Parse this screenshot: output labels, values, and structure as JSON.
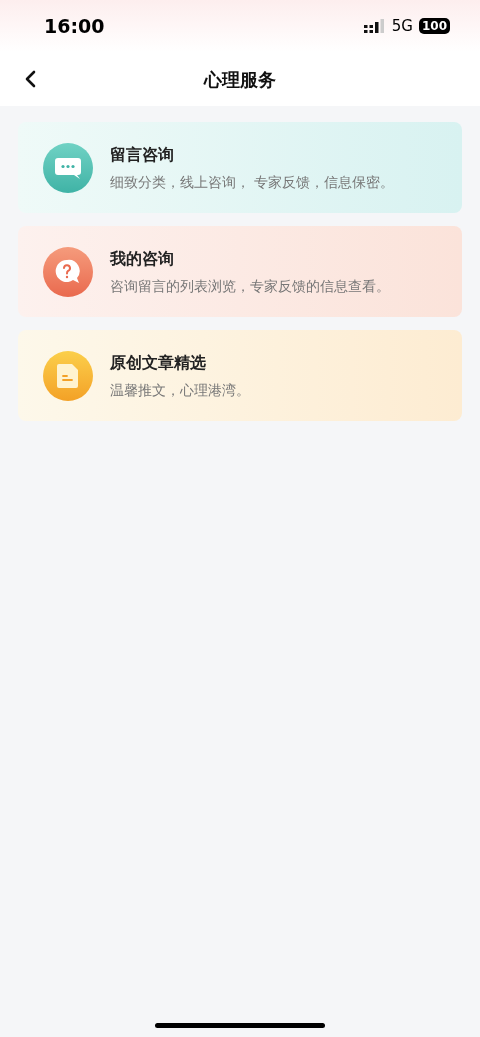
{
  "status_bar": {
    "time": "16:00",
    "network": "5G",
    "battery": "100"
  },
  "nav_bar": {
    "title": "心理服务"
  },
  "cards": [
    {
      "kind": "chat",
      "title": "留言咨询",
      "description": "细致分类，线上咨询， 专家反馈，信息保密。"
    },
    {
      "kind": "question",
      "title": "我的咨询",
      "description": "咨询留言的列表浏览，专家反馈的信息查看。"
    },
    {
      "kind": "document",
      "title": "原创文章精选",
      "description": "温馨推文，心理港湾。"
    }
  ]
}
